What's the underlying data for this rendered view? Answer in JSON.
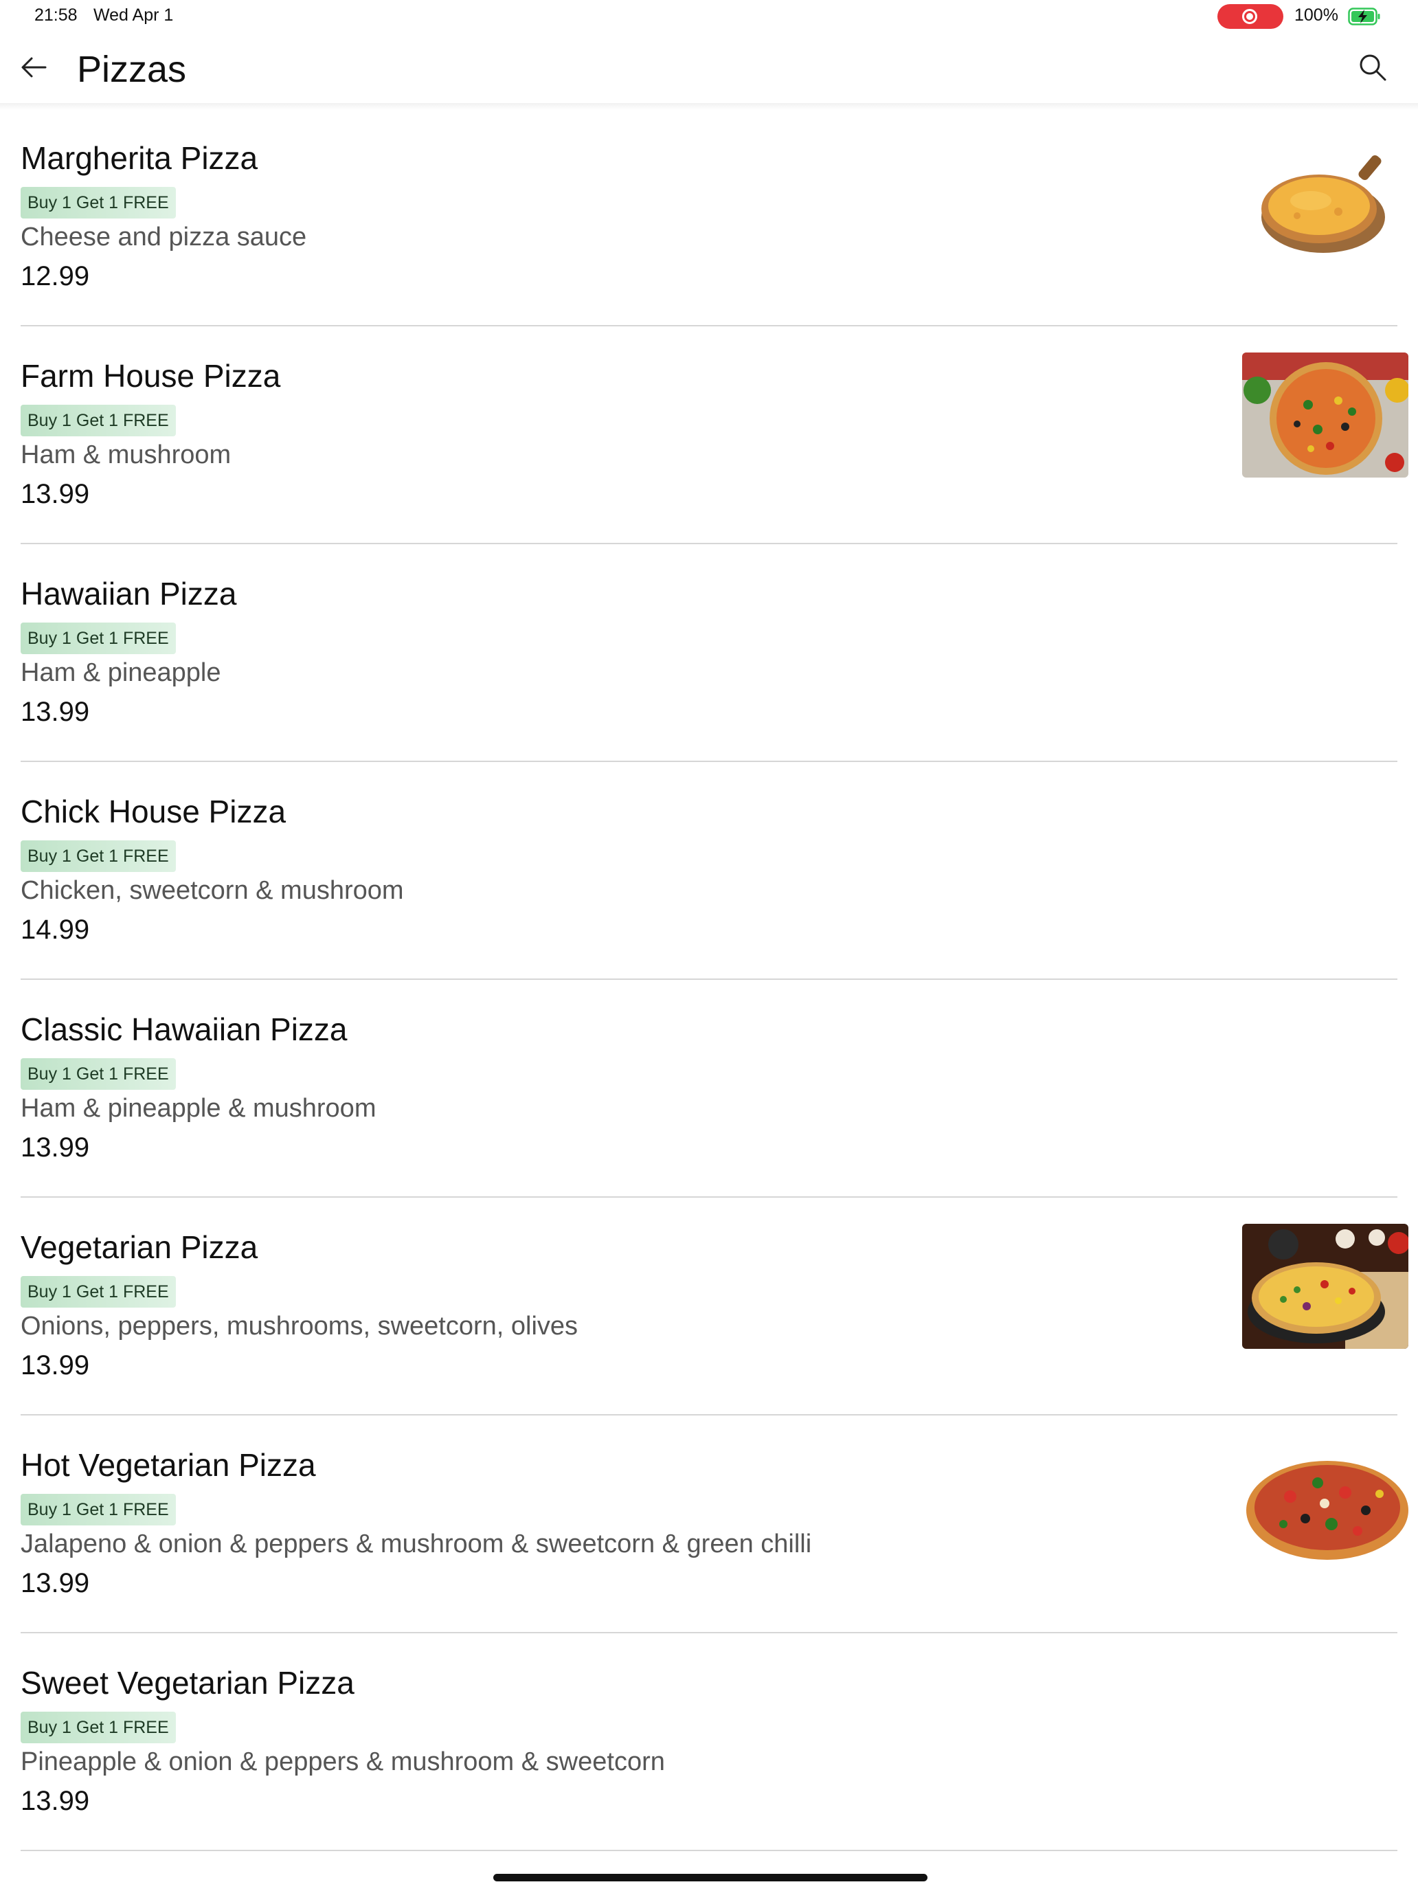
{
  "status_bar": {
    "time": "21:58",
    "date": "Wed Apr 1",
    "battery": "100%"
  },
  "header": {
    "title": "Pizzas",
    "back_icon": "arrow-left-icon",
    "search_icon": "search-icon"
  },
  "colors": {
    "badge_bg": "#c8e8d0",
    "record": "#e8353a",
    "battery": "#34c759"
  },
  "items": [
    {
      "name": "Margherita Pizza",
      "badge": "Buy 1 Get 1 FREE",
      "description": "Cheese and pizza sauce",
      "price": "12.99",
      "has_image": true,
      "image": "margherita-photo"
    },
    {
      "name": "Farm House Pizza",
      "badge": "Buy 1 Get 1 FREE",
      "description": "Ham & mushroom",
      "price": "13.99",
      "has_image": true,
      "image": "farmhouse-photo"
    },
    {
      "name": "Hawaiian Pizza",
      "badge": "Buy 1 Get 1 FREE",
      "description": "Ham & pineapple",
      "price": "13.99",
      "has_image": false
    },
    {
      "name": "Chick House Pizza",
      "badge": "Buy 1 Get 1 FREE",
      "description": "Chicken, sweetcorn & mushroom",
      "price": "14.99",
      "has_image": false
    },
    {
      "name": "Classic Hawaiian Pizza",
      "badge": "Buy 1 Get 1 FREE",
      "description": "Ham & pineapple & mushroom",
      "price": "13.99",
      "has_image": false
    },
    {
      "name": "Vegetarian Pizza",
      "badge": "Buy 1 Get 1 FREE",
      "description": "Onions, peppers, mushrooms, sweetcorn, olives",
      "price": "13.99",
      "has_image": true,
      "image": "vegetarian-photo"
    },
    {
      "name": "Hot Vegetarian Pizza",
      "badge": "Buy 1 Get 1 FREE",
      "description": "Jalapeno & onion & peppers & mushroom & sweetcorn & green chilli",
      "price": "13.99",
      "has_image": true,
      "image": "hot-vegetarian-photo"
    },
    {
      "name": "Sweet Vegetarian Pizza",
      "badge": "Buy 1 Get 1 FREE",
      "description": "Pineapple & onion & peppers & mushroom & sweetcorn",
      "price": "13.99",
      "has_image": false
    }
  ]
}
